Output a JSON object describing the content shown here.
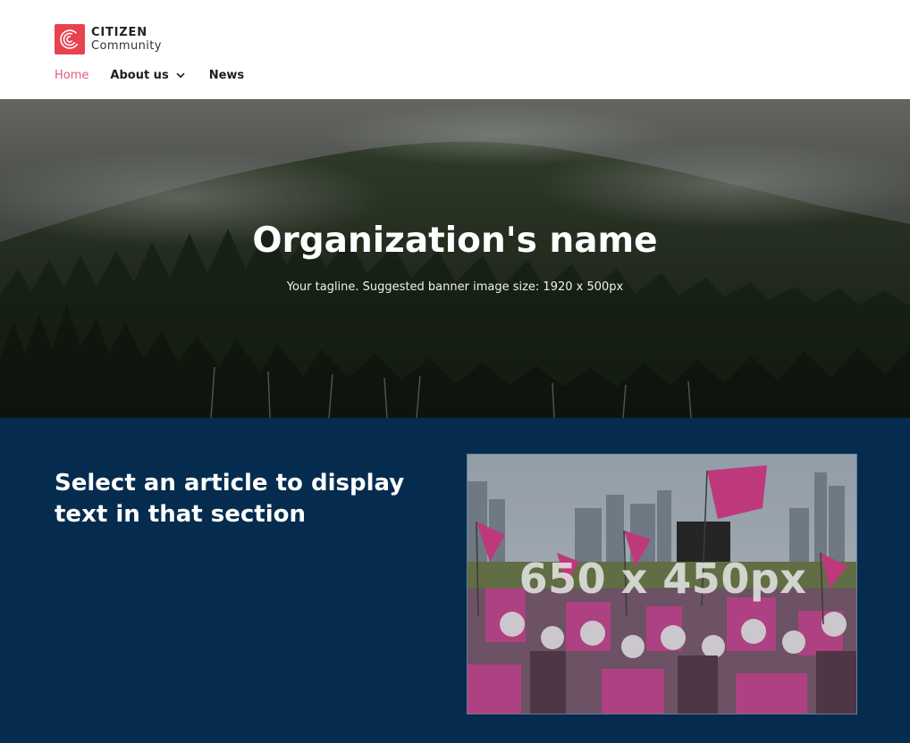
{
  "header": {
    "logo": {
      "line1": "CITIZEN",
      "line2": "Community",
      "color": "#e8424f"
    },
    "nav": [
      {
        "label": "Home",
        "active": true
      },
      {
        "label": "About us",
        "has_dropdown": true
      },
      {
        "label": "News"
      }
    ]
  },
  "banner": {
    "title": "Organization's name",
    "tagline": "Your tagline. Suggested banner image size: 1920 x 500px"
  },
  "article": {
    "heading": "Select an article to display text in that section",
    "image_placeholder": "650 x 450px",
    "background_color": "#052c4f"
  },
  "colors": {
    "nav_active": "#e8597a",
    "accent": "#e8424f"
  }
}
